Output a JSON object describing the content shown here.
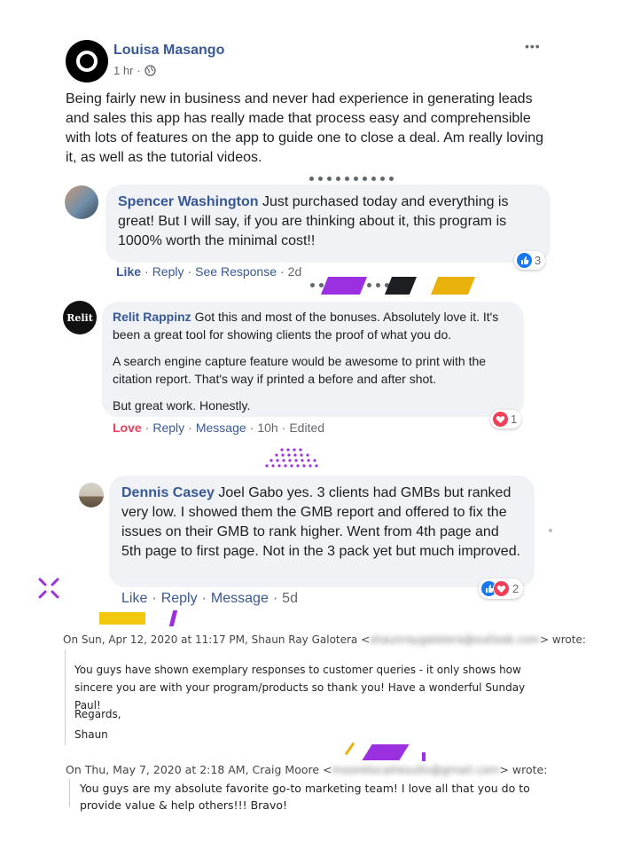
{
  "post": {
    "author": "Louisa Masango",
    "time": "1 hr",
    "more": "•••",
    "body": "Being fairly new in business and never had experience in generating leads and sales this app has really made that process easy and comprehensible with lots of features on the app to guide one to close a deal. Am really loving it, as well as the tutorial videos."
  },
  "comments": [
    {
      "author": "Spencer Washington",
      "text": "Just purchased today and everything is great! But I will say, if you are thinking about it, this program is 1000% worth the minimal cost!!",
      "actions": [
        "Like",
        "Reply",
        "See Response"
      ],
      "time": "2d",
      "reaction_count": "3"
    },
    {
      "author": "Relit Rappinz",
      "avatar_text": "Relit",
      "paragraphs": [
        "Got this and most of the bonuses. Absolutely love it. It's been a great tool for showing clients the proof of what you do.",
        "A search engine capture feature would be awesome to print with the citation report. That's way if printed a before and after shot.",
        "But great work. Honestly."
      ],
      "actions": [
        "Love",
        "Reply",
        "Message"
      ],
      "time": "10h",
      "edited": "Edited",
      "reaction_count": "1"
    },
    {
      "author": "Dennis Casey",
      "text": "Joel Gabo yes. 3 clients had GMBs but ranked very low. I showed them the GMB report and offered to fix the issues on their GMB to rank higher. Went from 4th page and 5th page to first page. Not in the 3 pack yet but much improved.",
      "actions": [
        "Like",
        "Reply",
        "Message"
      ],
      "time": "5d",
      "reaction_count": "2"
    }
  ],
  "emails": [
    {
      "header_pre": "On Sun, Apr 12, 2020 at 11:17 PM, Shaun Ray Galotera <",
      "header_email": "shaunraygalotera@outlook.com",
      "header_post": "> wrote:",
      "body": "You guys have shown exemplary responses to customer queries - it only shows how sincere you are with your program/products so thank you!  Have a wonderful Sunday Paul!",
      "regards": "Regards,",
      "signature": "Shaun"
    },
    {
      "header_pre": "On Thu, May 7, 2020 at 2:18 AM, Craig Moore <",
      "header_email": "moorelocalresults@gmail.com",
      "header_post": "> wrote:",
      "body": "You guys are my absolute favorite go-to marketing team! I love all that you do to provide value & help others!!! Bravo!"
    }
  ],
  "colors": {
    "name": "#385898",
    "bubble": "#f0f2f5",
    "love": "#f33e58",
    "like": "#1877f2",
    "accent_purple": "#9b30e0",
    "accent_yellow": "#e8b10c"
  }
}
